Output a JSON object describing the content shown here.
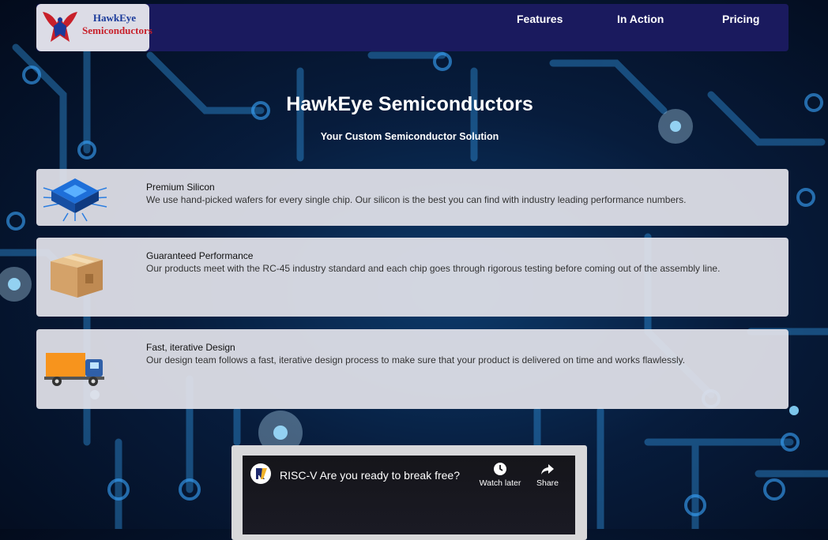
{
  "brand": {
    "line1": "HawkEye",
    "line2": "Semiconductors"
  },
  "nav": {
    "items": [
      {
        "label": "Features"
      },
      {
        "label": "In Action"
      },
      {
        "label": "Pricing"
      }
    ]
  },
  "hero": {
    "title": "HawkEye Semiconductors",
    "subtitle": "Your Custom Semiconductor Solution"
  },
  "features": [
    {
      "icon": "chip-icon",
      "title": "Premium Silicon",
      "description": "We use hand-picked wafers for every single chip. Our silicon is the best you can find with industry leading performance numbers."
    },
    {
      "icon": "box-icon",
      "title": "Guaranteed Performance",
      "description": "Our products meet with the RC-45 industry standard and each chip goes through rigorous testing before coming out of the assembly line."
    },
    {
      "icon": "truck-icon",
      "title": "Fast, iterative Design",
      "description": "Our design team follows a fast, iterative design process to make sure that your product is delivered on time and works flawlessly."
    }
  ],
  "video": {
    "title": "RISC-V Are you ready to break free?",
    "watch_later": "Watch later",
    "share": "Share"
  },
  "colors": {
    "navbar": "#1a1a5e",
    "card": "#e2e2ea",
    "background": "#071c3c",
    "circuit": "#2aa3ff"
  }
}
